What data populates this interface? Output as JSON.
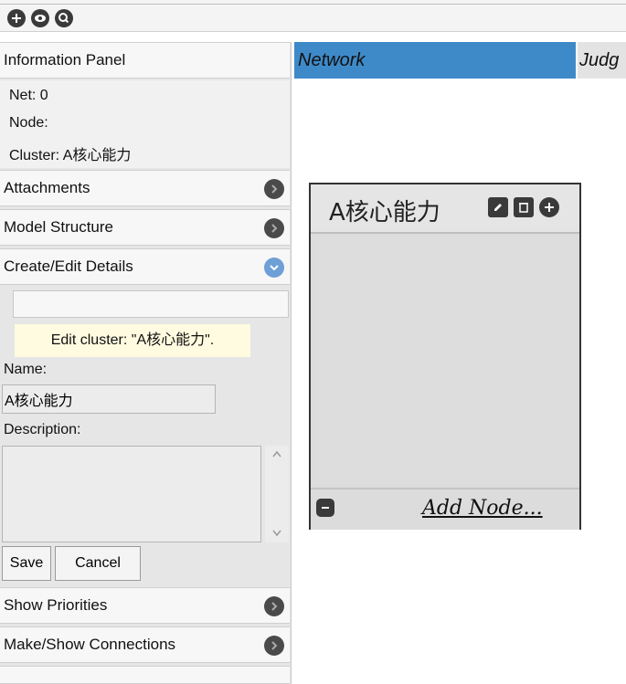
{
  "toolbar": {
    "buttons": [
      {
        "icon": "plus-icon"
      },
      {
        "icon": "eye-icon"
      },
      {
        "icon": "magnify-icon"
      }
    ]
  },
  "info_panel": {
    "title": "Information Panel",
    "net": "Net: 0",
    "node": "Node:",
    "cluster": "Cluster: A核心能力"
  },
  "sections": {
    "attachments": "Attachments",
    "model_structure": "Model Structure",
    "create_edit": "Create/Edit Details",
    "show_priorities": "Show Priorities",
    "make_show_connections": "Make/Show Connections"
  },
  "edit": {
    "tooltip": "Edit cluster: \"A核心能力\".",
    "name_label": "Name:",
    "name_value": "A核心能力",
    "description_label": "Description:",
    "save": "Save",
    "cancel": "Cancel"
  },
  "tabs": {
    "network": "Network",
    "judg": "Judg"
  },
  "cluster_box": {
    "title": "A核心能力",
    "add_node": "Add Node..."
  },
  "colors": {
    "tab_active": "#3e8ac9",
    "tooltip_bg": "#fffbe0",
    "chevron_expanded": "#6e9fd6"
  }
}
